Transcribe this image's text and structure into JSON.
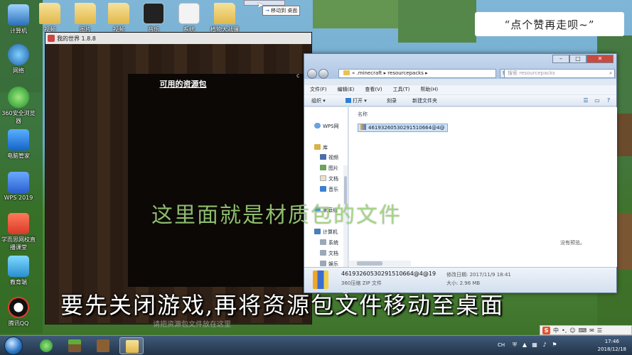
{
  "desktop": {
    "icons": [
      {
        "label": "计算机"
      },
      {
        "label": "网络"
      },
      {
        "label": "360安全浏览器"
      },
      {
        "label": "电脑管家"
      },
      {
        "label": "WPS 2019"
      },
      {
        "label": "学而思网校直播课堂"
      },
      {
        "label": "教育端"
      },
      {
        "label": "腾讯QQ"
      },
      {
        "label": "视频"
      },
      {
        "label": "图片"
      },
      {
        "label": "视频"
      },
      {
        "label": "音乐"
      },
      {
        "label": "系统"
      },
      {
        "label": "植物大战僵"
      }
    ]
  },
  "drag": {
    "label": "移动到 桌面",
    "arrow": "→"
  },
  "sign": {
    "text": "“点个赞再走呗~”"
  },
  "minecraft": {
    "title": "我的世界 1.8.8",
    "panel_title": "可用的资源包",
    "small_label": "c",
    "hint": "请把资源包文件放在这里"
  },
  "explorer": {
    "address": "« .minecraft ▸ resourcepacks ▸",
    "search_placeholder": "搜索 resourcepacks",
    "menu": [
      "文件(F)",
      "编辑(E)",
      "查看(V)",
      "工具(T)",
      "帮助(H)"
    ],
    "toolbar": {
      "organize": "组织 ▾",
      "open": "打开 ▾",
      "burn": "刻录",
      "new_folder": "新建文件夹"
    },
    "nav": [
      {
        "label": "WPS网",
        "icon": "cloud"
      },
      {
        "label": "库",
        "icon": "library"
      },
      {
        "label": "视频",
        "icon": "video"
      },
      {
        "label": "图片",
        "icon": "picture"
      },
      {
        "label": "文档",
        "icon": "document"
      },
      {
        "label": "音乐",
        "icon": "music"
      },
      {
        "label": "家庭组",
        "icon": "homegroup"
      },
      {
        "label": "计算机",
        "icon": "computer"
      },
      {
        "label": "系统",
        "icon": "drive"
      },
      {
        "label": "文档",
        "icon": "drive"
      },
      {
        "label": "娱乐",
        "icon": "drive"
      }
    ],
    "column_name": "名称",
    "file_name": "46193260530291510664@4@",
    "empty_preview": "没有预览。",
    "details": {
      "name": "46193260530291510664@4@19",
      "type": "360压缩 ZIP 文件",
      "modified_label": "修改日期: 2017/11/9 18:41",
      "size_label": "大小: 2.96 MB"
    }
  },
  "captions": {
    "line1": "这里面就是材质包的文件",
    "line2": "要先关闭游戏,再将资源包文件移动至桌面"
  },
  "taskbar": {
    "ime": [
      "中",
      "•,",
      "☺",
      "⌨",
      "✉",
      "☰"
    ],
    "lang": "CH",
    "time": "17:46",
    "date": "2018/12/18"
  }
}
